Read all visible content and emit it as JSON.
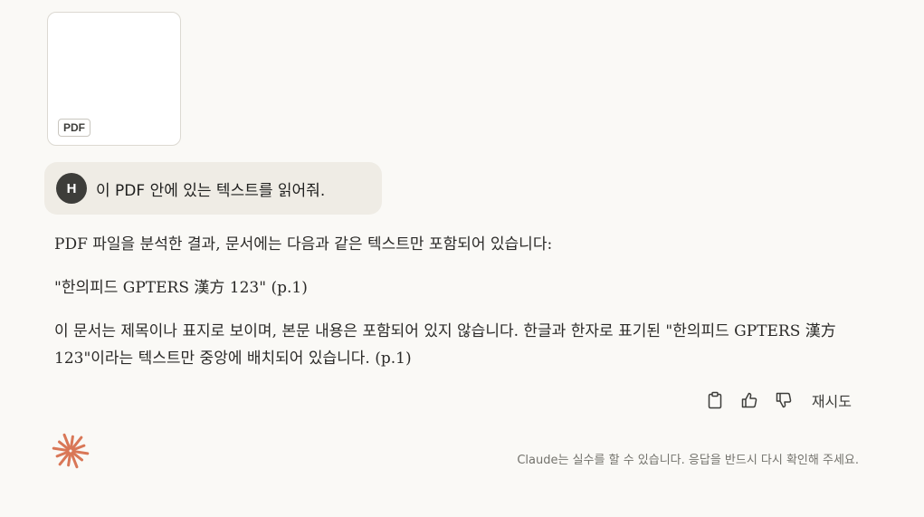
{
  "attachment": {
    "badge": "PDF"
  },
  "user_message": {
    "avatar_initial": "H",
    "text": "이 PDF 안에 있는 텍스트를 읽어줘."
  },
  "response": {
    "paragraphs": [
      "PDF 파일을 분석한 결과, 문서에는 다음과 같은 텍스트만 포함되어 있습니다:",
      "\"한의피드 GPTERS 漢方 123\" (p.1)",
      "이 문서는 제목이나 표지로 보이며, 본문 내용은 포함되어 있지 않습니다. 한글과 한자로 표기된 \"한의피드 GPTERS 漢方 123\"이라는 텍스트만 중앙에 배치되어 있습니다. (p.1)"
    ]
  },
  "actions": {
    "icons": [
      "clipboard-icon",
      "thumbs-up-icon",
      "thumbs-down-icon"
    ],
    "retry_label": "재시도"
  },
  "footer": {
    "logo": "claude-starburst-icon",
    "logo_color": "#d97757",
    "disclaimer": "Claude는 실수를 할 수 있습니다. 응답을 반드시 다시 확인해 주세요."
  }
}
